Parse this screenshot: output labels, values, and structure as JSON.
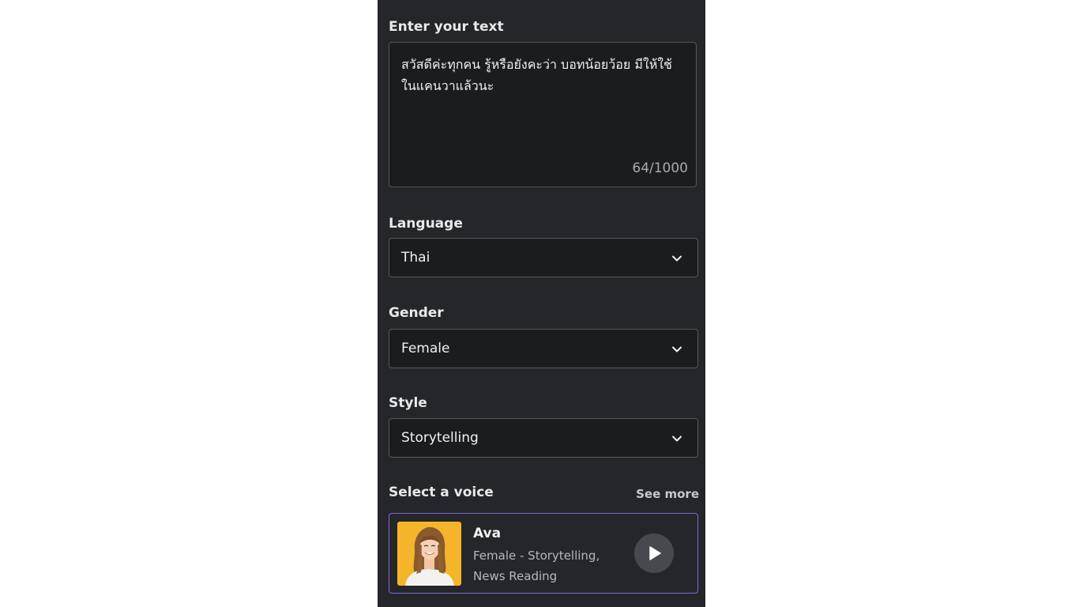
{
  "text_input": {
    "label": "Enter your text",
    "value": "สวัสดีค่ะทุกคน รู้หรือยังคะว่า บอทน้อยว้อย มีให้ใช้ในแคนวาแล้วนะ",
    "counter": "64/1000"
  },
  "language": {
    "label": "Language",
    "selected": "Thai"
  },
  "gender": {
    "label": "Gender",
    "selected": "Female"
  },
  "style": {
    "label": "Style",
    "selected": "Storytelling"
  },
  "voice_section": {
    "label": "Select a voice",
    "see_more": "See more",
    "voice": {
      "name": "Ava",
      "description": "Female - Storytelling, News Reading"
    }
  },
  "colors": {
    "panel_bg": "#252629",
    "field_bg": "#1b1c1e",
    "accent_border": "#7f6ad8",
    "avatar_bg": "#f5b52a"
  },
  "icons": {
    "dropdown": "chevron-down-icon",
    "play": "play-icon"
  }
}
